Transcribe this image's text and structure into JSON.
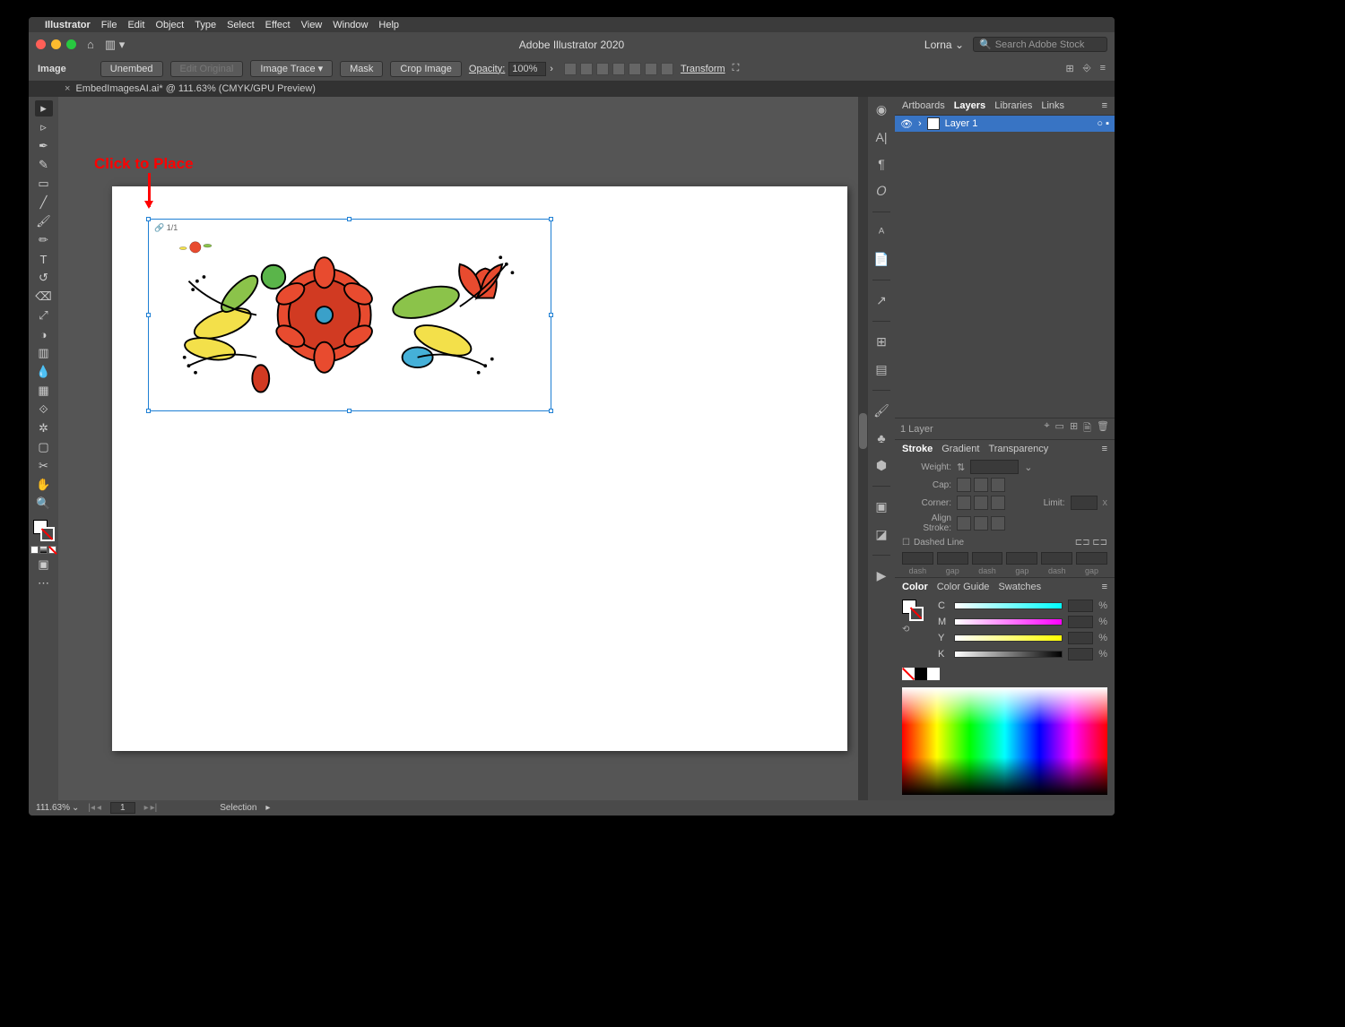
{
  "mac_menu": {
    "app": "Illustrator",
    "items": [
      "File",
      "Edit",
      "Object",
      "Type",
      "Select",
      "Effect",
      "View",
      "Window",
      "Help"
    ]
  },
  "titlebar": {
    "title": "Adobe Illustrator 2020",
    "user": "Lorna",
    "search_placeholder": "Search Adobe Stock"
  },
  "controlbar": {
    "context": "Image",
    "unembed": "Unembed",
    "edit_original": "Edit Original",
    "image_trace": "Image Trace",
    "mask": "Mask",
    "crop": "Crop Image",
    "opacity_label": "Opacity:",
    "opacity_value": "100%",
    "transform": "Transform"
  },
  "doc_tab": {
    "name": "EmbedImagesAI.ai* @ 111.63% (CMYK/GPU Preview)"
  },
  "annotation": {
    "text": "Click to Place"
  },
  "placed": {
    "counter": "1/1"
  },
  "panels": {
    "top_tabs": [
      "Artboards",
      "Layers",
      "Libraries",
      "Links"
    ],
    "top_active": "Layers",
    "layer_name": "Layer 1",
    "layer_count": "1 Layer",
    "stroke_tabs": [
      "Stroke",
      "Gradient",
      "Transparency"
    ],
    "stroke_active": "Stroke",
    "stroke": {
      "weight": "Weight:",
      "cap": "Cap:",
      "corner": "Corner:",
      "limit": "Limit:",
      "align": "Align Stroke:",
      "dashed": "Dashed Line",
      "dash_caps": [
        "dash",
        "gap",
        "dash",
        "gap",
        "dash",
        "gap"
      ]
    },
    "color_tabs": [
      "Color",
      "Color Guide",
      "Swatches"
    ],
    "color_active": "Color",
    "color": {
      "c": "C",
      "m": "M",
      "y": "Y",
      "k": "K",
      "pct": "%"
    }
  },
  "statusbar": {
    "zoom": "111.63%",
    "artboard": "1",
    "tool": "Selection"
  }
}
